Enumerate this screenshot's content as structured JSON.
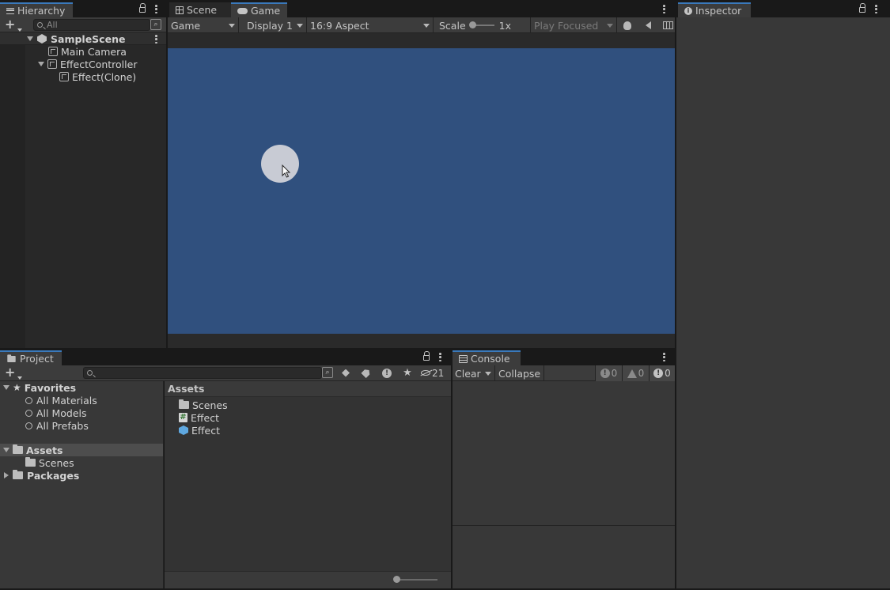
{
  "hierarchy": {
    "tab_label": "Hierarchy",
    "search_placeholder": "All",
    "scene_name": "SampleScene",
    "items": [
      {
        "label": "Main Camera"
      },
      {
        "label": "EffectController"
      },
      {
        "label": "Effect(Clone)"
      }
    ]
  },
  "center": {
    "tabs": [
      {
        "label": "Scene"
      },
      {
        "label": "Game"
      }
    ],
    "toolbar": {
      "view_mode": "Game",
      "display": "Display 1",
      "aspect": "16:9 Aspect",
      "scale_label": "Scale",
      "scale_value": "1x",
      "play_mode": "Play Focused"
    },
    "game_bg": "#30507e",
    "circle_color": "#c8cbd4"
  },
  "inspector": {
    "tab_label": "Inspector"
  },
  "project": {
    "tab_label": "Project",
    "hidden_count": "21",
    "favorites": {
      "label": "Favorites",
      "items": [
        {
          "label": "All Materials"
        },
        {
          "label": "All Models"
        },
        {
          "label": "All Prefabs"
        }
      ]
    },
    "tree": {
      "assets_label": "Assets",
      "scenes_label": "Scenes",
      "packages_label": "Packages"
    },
    "content": {
      "header": "Assets",
      "items": [
        {
          "label": "Scenes"
        },
        {
          "label": "Effect"
        },
        {
          "label": "Effect"
        }
      ]
    }
  },
  "console": {
    "tab_label": "Console",
    "clear_label": "Clear",
    "collapse_label": "Collapse",
    "info_count": "0",
    "warn_count": "0",
    "error_count": "0"
  }
}
